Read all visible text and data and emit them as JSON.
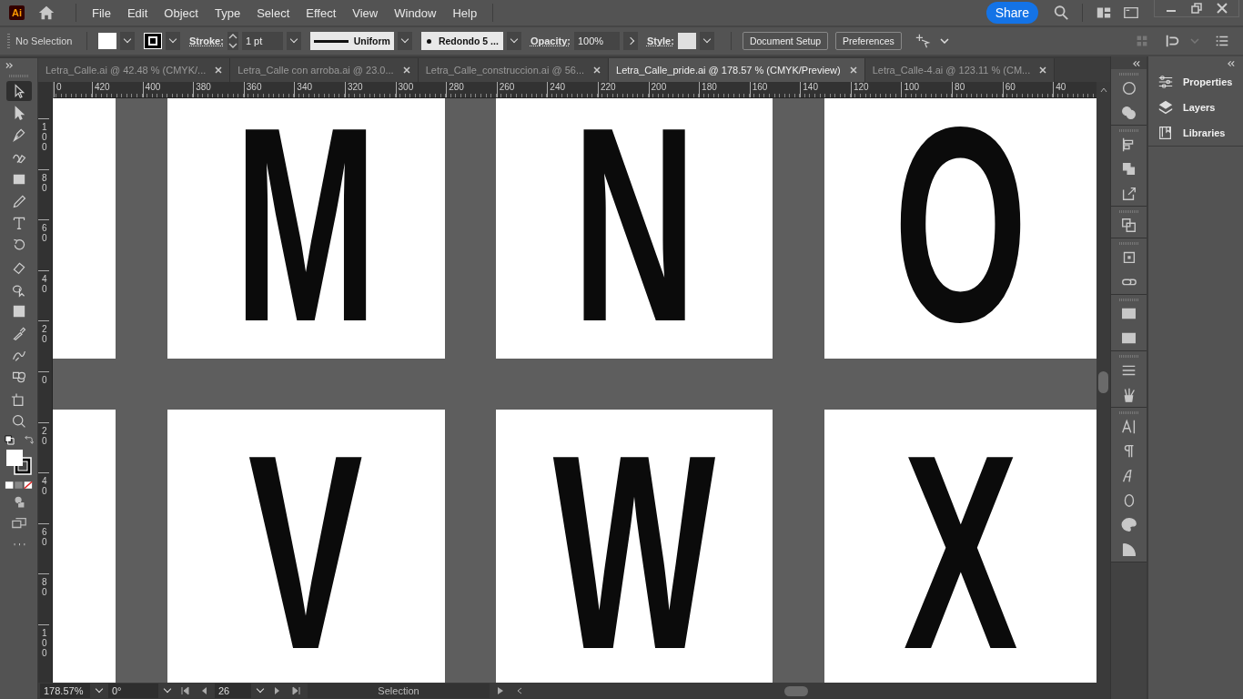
{
  "app_icon": "Ai",
  "menu": [
    "File",
    "Edit",
    "Object",
    "Type",
    "Select",
    "Effect",
    "View",
    "Window",
    "Help"
  ],
  "share": "Share",
  "control_bar": {
    "selection": "No Selection",
    "stroke_label": "Stroke:",
    "stroke_weight": "1 pt",
    "profile": "Uniform",
    "brush": "Redondo 5 ...",
    "opacity_label": "Opacity:",
    "opacity": "100%",
    "style_label": "Style:",
    "buttons": [
      "Document Setup",
      "Preferences"
    ]
  },
  "tabs": [
    {
      "label": "Letra_Calle.ai @ 42.48 % (CMYK/...",
      "selected": false
    },
    {
      "label": "Letra_Calle con arroba.ai @ 23.0...",
      "selected": false
    },
    {
      "label": "Letra_Calle_construccion.ai @ 56...",
      "selected": false
    },
    {
      "label": "Letra_Calle_pride.ai @ 178.57 % (CMYK/Preview)",
      "selected": true
    },
    {
      "label": "Letra_Calle-4.ai @ 123.11 % (CM...",
      "selected": false
    }
  ],
  "ruler_h": [
    "0",
    "420",
    "400",
    "380",
    "360",
    "340",
    "320",
    "300",
    "280",
    "260",
    "240",
    "220",
    "200",
    "180",
    "160",
    "140",
    "120",
    "100",
    "80",
    "60",
    "40"
  ],
  "ruler_v": [
    "100",
    "80",
    "60",
    "40",
    "20",
    "0",
    "20",
    "40",
    "60",
    "80",
    "100"
  ],
  "artboard_rows": [
    {
      "letters": [
        "M",
        "N",
        "O"
      ]
    },
    {
      "letters": [
        "V",
        "W",
        "X"
      ]
    }
  ],
  "panels": [
    {
      "label": "Properties"
    },
    {
      "label": "Layers"
    },
    {
      "label": "Libraries"
    }
  ],
  "status": {
    "zoom": "178.57%",
    "rotation": "0°",
    "artboard": "26",
    "tool": "Selection"
  }
}
